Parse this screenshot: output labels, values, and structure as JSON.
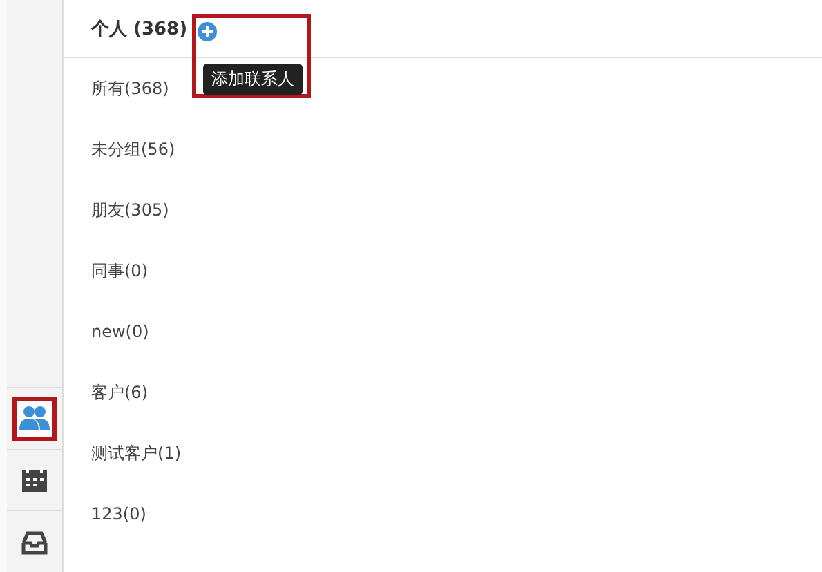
{
  "header": {
    "title": "个人 (368)",
    "tooltip": "添加联系人"
  },
  "groups": [
    {
      "label": "所有(368)"
    },
    {
      "label": "未分组(56)"
    },
    {
      "label": "朋友(305)"
    },
    {
      "label": "同事(0)"
    },
    {
      "label": "new(0)"
    },
    {
      "label": "客户(6)"
    },
    {
      "label": "测试客户(1)"
    },
    {
      "label": "123(0)"
    }
  ],
  "sidebar": [
    {
      "kind": "contacts",
      "selected": true
    },
    {
      "kind": "calendar",
      "selected": false
    },
    {
      "kind": "inbox",
      "selected": false
    }
  ]
}
